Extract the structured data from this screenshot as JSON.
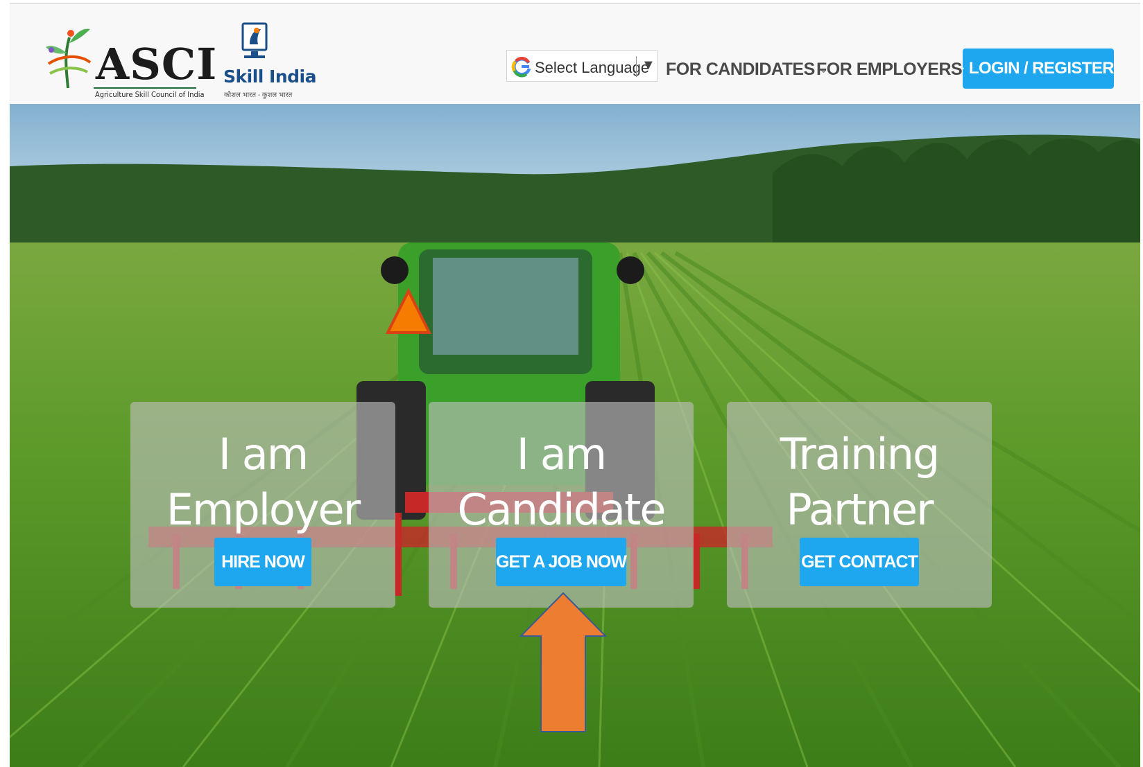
{
  "header": {
    "asci_logo": {
      "title": "ASCI",
      "subtitle": "Agriculture Skill Council of India"
    },
    "skill_india_logo": {
      "title": "Skill India",
      "tagline": "कौशल भारत - कुशल भारत"
    },
    "language_selector": {
      "label": "Select Language",
      "arrow": "▼",
      "icon": "google-g-icon"
    },
    "nav": {
      "candidates": "FOR CANDIDATES",
      "employers": "FOR EMPLOYERS",
      "chevron": "⌄"
    },
    "login": {
      "label": "LOGIN / REGISTER",
      "icon": "lock-icon"
    }
  },
  "hero": {
    "background": "tractor-in-green-field-photo",
    "cards": [
      {
        "line1": "I am",
        "line2": "Employer",
        "button": "HIRE NOW"
      },
      {
        "line1": "I am",
        "line2": "Candidate",
        "button": "GET A JOB NOW"
      },
      {
        "line1": "Training",
        "line2": "Partner",
        "button": "GET CONTACT"
      }
    ],
    "annotation": "orange-up-arrow"
  },
  "colors": {
    "accent": "#1ea7ee",
    "header_bg": "#f8f8f8",
    "arrow": "#ed7d31",
    "card_overlay": "#bebebe"
  }
}
